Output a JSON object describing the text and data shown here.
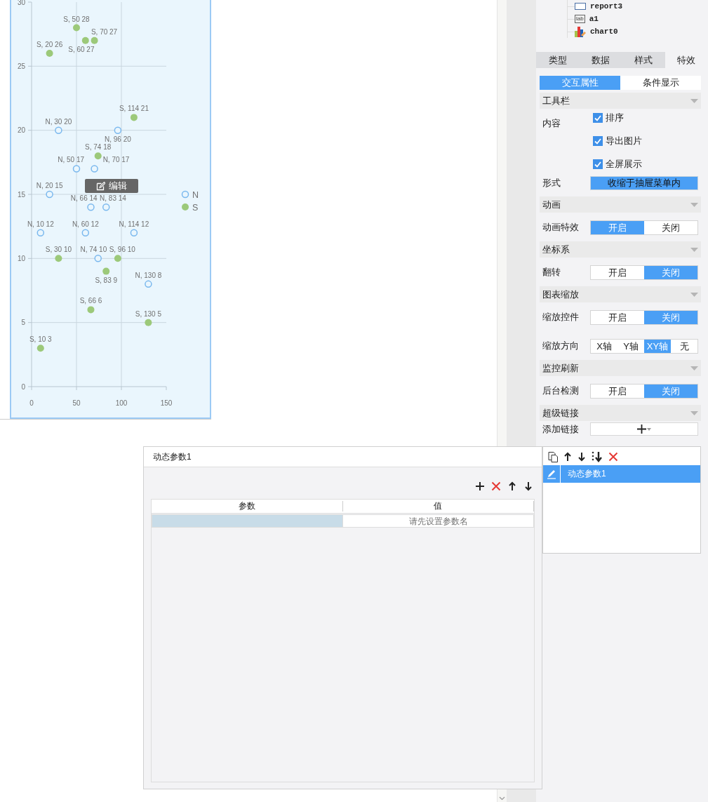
{
  "chart_panel": {
    "chart_data": {
      "type": "scatter",
      "xlim": [
        0,
        150
      ],
      "ylim": [
        0,
        30
      ],
      "xticks": [
        0,
        50,
        100,
        150
      ],
      "yticks": [
        0,
        5,
        10,
        15,
        20,
        25,
        30
      ],
      "grid": true,
      "legend": "right",
      "series": [
        {
          "name": "N",
          "color": "#7ab8ee",
          "marker": "circle",
          "x": [
            30,
            96,
            50,
            70,
            20,
            66,
            83,
            10,
            60,
            114,
            74,
            130
          ],
          "values": [
            20,
            20,
            17,
            17,
            15,
            14,
            14,
            12,
            12,
            12,
            10,
            8
          ]
        },
        {
          "name": "S",
          "color": "#9cc97a",
          "marker": "circle",
          "x": [
            50,
            60,
            70,
            20,
            114,
            74,
            30,
            96,
            83,
            66,
            130,
            10
          ],
          "values": [
            28,
            27,
            27,
            26,
            21,
            18,
            10,
            10,
            9,
            6,
            5,
            3
          ]
        }
      ],
      "annotations": [
        {
          "x": 30,
          "y": 20,
          "text": "N, 30 20"
        },
        {
          "x": 96,
          "y": 20,
          "text": "N, 96 20"
        },
        {
          "x": 50,
          "y": 17,
          "text": "N, 50 17"
        },
        {
          "x": 70,
          "y": 17,
          "text": "N, 70 17"
        },
        {
          "x": 20,
          "y": 15,
          "text": "N, 20 15"
        },
        {
          "x": 66,
          "y": 14,
          "text": "N, 66 14"
        },
        {
          "x": 83,
          "y": 14,
          "text": "N, 83 14"
        },
        {
          "x": 10,
          "y": 12,
          "text": "N, 10 12"
        },
        {
          "x": 60,
          "y": 12,
          "text": "N, 60 12"
        },
        {
          "x": 114,
          "y": 12,
          "text": "N, 114 12"
        },
        {
          "x": 74,
          "y": 10,
          "text": "N, 74 10"
        },
        {
          "x": 130,
          "y": 8,
          "text": "N, 130 8"
        },
        {
          "x": 50,
          "y": 28,
          "text": "S, 50 28"
        },
        {
          "x": 60,
          "y": 27,
          "text": "S, 60 27"
        },
        {
          "x": 70,
          "y": 27,
          "text": "S, 70 27"
        },
        {
          "x": 20,
          "y": 26,
          "text": "S, 20 26"
        },
        {
          "x": 114,
          "y": 21,
          "text": "S, 114 21"
        },
        {
          "x": 74,
          "y": 18,
          "text": "S, 74 18"
        },
        {
          "x": 30,
          "y": 10,
          "text": "S, 30 10"
        },
        {
          "x": 96,
          "y": 10,
          "text": "S, 96 10"
        },
        {
          "x": 83,
          "y": 9,
          "text": "S, 83 9"
        },
        {
          "x": 66,
          "y": 6,
          "text": "S, 66 6"
        },
        {
          "x": 130,
          "y": 5,
          "text": "S, 130 5"
        },
        {
          "x": 10,
          "y": 3,
          "text": "S, 10 3"
        }
      ]
    },
    "edit_button": {
      "label": "编辑"
    }
  },
  "component_tree": [
    {
      "label": "report3",
      "kind": "report"
    },
    {
      "label": "a1",
      "kind": "label",
      "badge": "lab"
    },
    {
      "label": "chart0",
      "kind": "chart"
    }
  ],
  "property_tabs": [
    {
      "label": "类型",
      "selected": false
    },
    {
      "label": "数据",
      "selected": false
    },
    {
      "label": "样式",
      "selected": false
    },
    {
      "label": "特效",
      "selected": true
    }
  ],
  "sub_tabs": [
    {
      "label": "交互属性",
      "selected": true
    },
    {
      "label": "条件显示",
      "selected": false
    }
  ],
  "sections": [
    {
      "title": "工具栏",
      "rows": [
        {
          "kind": "checkboxes",
          "label": "内容",
          "options": [
            {
              "label": "排序",
              "checked": true
            },
            {
              "label": "导出图片",
              "checked": true
            },
            {
              "label": "全屏展示",
              "checked": true
            }
          ]
        },
        {
          "kind": "dropdown",
          "label": "形式",
          "value": "收缩于抽屉菜单内"
        }
      ]
    },
    {
      "title": "动画",
      "rows": [
        {
          "kind": "segmented",
          "label": "动画特效",
          "options": [
            {
              "label": "开启",
              "selected": true
            },
            {
              "label": "关闭",
              "selected": false
            }
          ]
        }
      ]
    },
    {
      "title": "坐标系",
      "rows": [
        {
          "kind": "segmented",
          "label": "翻转",
          "options": [
            {
              "label": "开启",
              "selected": false
            },
            {
              "label": "关闭",
              "selected": true
            }
          ]
        }
      ]
    },
    {
      "title": "图表缩放",
      "rows": [
        {
          "kind": "segmented",
          "label": "缩放控件",
          "options": [
            {
              "label": "开启",
              "selected": false
            },
            {
              "label": "关闭",
              "selected": true
            }
          ]
        },
        {
          "kind": "segmented",
          "label": "缩放方向",
          "options": [
            {
              "label": "X轴",
              "selected": false
            },
            {
              "label": "Y轴",
              "selected": false
            },
            {
              "label": "XY轴",
              "selected": true
            },
            {
              "label": "无",
              "selected": false
            }
          ]
        }
      ]
    },
    {
      "title": "监控刷新",
      "rows": [
        {
          "kind": "segmented",
          "label": "后台检测",
          "options": [
            {
              "label": "开启",
              "selected": false
            },
            {
              "label": "关闭",
              "selected": true
            }
          ]
        }
      ]
    },
    {
      "title": "超级链接",
      "rows": [
        {
          "kind": "add",
          "label": "添加链接"
        }
      ]
    }
  ],
  "dialog": {
    "title": "动态参数1",
    "columns": [
      "参数",
      "值"
    ],
    "rows": [
      {
        "value_placeholder": "请先设置参数名",
        "selected": true
      }
    ]
  },
  "link_list": {
    "items": [
      {
        "label": "动态参数1",
        "selected": true
      }
    ]
  }
}
